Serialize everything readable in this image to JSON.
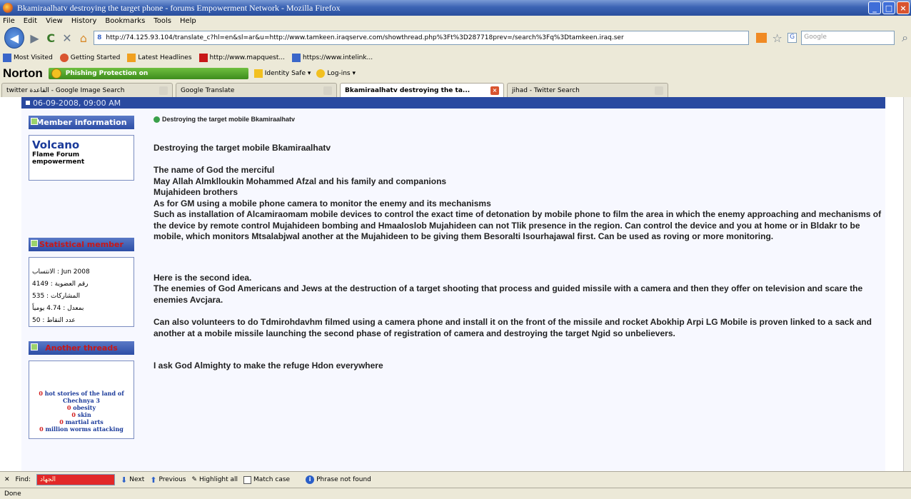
{
  "window": {
    "title": "Bkamiraalhatv destroying the target phone - forums Empowerment Network - Mozilla Firefox"
  },
  "menu": [
    "File",
    "Edit",
    "View",
    "History",
    "Bookmarks",
    "Tools",
    "Help"
  ],
  "nav": {
    "url": "http://74.125.93.104/translate_c?hl=en&sl=ar&u=http://www.tamkeen.iraqserve.com/showthread.php%3Ft%3D287718prev=/search%3Fq%3Dtamkeen.iraq.ser",
    "search_placeholder": "Google"
  },
  "bookmarks": [
    {
      "label": "Most Visited",
      "color": "#3a66c9"
    },
    {
      "label": "Getting Started",
      "color": "#d9542f"
    },
    {
      "label": "Latest Headlines",
      "color": "#f0a020"
    },
    {
      "label": "http://www.mapquest...",
      "color": "#c81818"
    },
    {
      "label": "https://www.intelink...",
      "color": "#3a66c9"
    }
  ],
  "norton": {
    "logo": "Norton",
    "phishing": "Phishing Protection on",
    "identity": "Identity Safe ▾",
    "logins": "Log-ins ▾"
  },
  "tabs": [
    {
      "label": "twitter القاعدة - Google Image Search",
      "active": false
    },
    {
      "label": "Google Translate",
      "active": false
    },
    {
      "label": "Bkamiraalhatv destroying the ta...",
      "active": true
    },
    {
      "label": "jihad - Twitter Search",
      "active": false
    }
  ],
  "post": {
    "date": "06-09-2008, 09:00 AM",
    "member_info_title": "Member information",
    "member_name": "Volcano",
    "member_sub1": "Flame Forum",
    "member_sub2": "empowerment",
    "stats_title": "Statistical member",
    "stats": [
      "الانتساب : Jun 2008",
      "رقم العضوية : 4149",
      "المشاركات : 535",
      "بمعدل : 4.74 يومياً",
      "عدد النقاط : 50"
    ],
    "threads_title": "Another threads",
    "threads": [
      {
        "num": "0",
        "text": "hot stories of the land of Chechnya 3"
      },
      {
        "num": "0",
        "text": "obesity"
      },
      {
        "num": "0",
        "text": "skin"
      },
      {
        "num": "0",
        "text": "martial arts"
      },
      {
        "num": "0",
        "text": "million worms attacking"
      }
    ],
    "intro": "Destroying the target mobile Bkamiraalhatv",
    "paragraphs": [
      "Destroying the target mobile Bkamiraalhatv",
      "The name of God the merciful",
      "May Allah Almklloukin Mohammed Afzal and his family and companions",
      "Mujahideen brothers",
      "As for GM using a mobile phone camera to monitor the enemy and its mechanisms",
      "Such as installation of Alcamiraomam mobile devices to control the exact time of detonation by mobile phone to film the area in which the enemy approaching and mechanisms of the device by remote control Mujahideen bombing and Hmaaloslob Mujahideen can not Tlik presence in the region. Can control the device and you at home or in Bldakr to be mobile, which monitors Mtsalabjwal another at the Mujahideen to be giving them Besoralti Isourhajawal first. Can be used as roving or more monitoring.",
      "Here is the second idea.",
      "The enemies of God Americans and Jews at the destruction of a target shooting that process and guided missile with a camera and then they offer on television and scare the enemies Avcjara.",
      "Can also volunteers to do Tdmirohdavhm filmed using a camera phone and install it on the front of the missile and rocket Abokhip Arpi LG Mobile is proven linked to a sack and another at a mobile missile launching the second phase of registration of camera and destroying the target Ngid so unbelievers.",
      "I ask God Almighty to make the refuge Hdon everywhere"
    ]
  },
  "find": {
    "label": "Find:",
    "value": "الجهاد",
    "next": "Next",
    "previous": "Previous",
    "highlight": "Highlight all",
    "matchcase": "Match case",
    "status": "Phrase not found"
  },
  "status": "Done"
}
